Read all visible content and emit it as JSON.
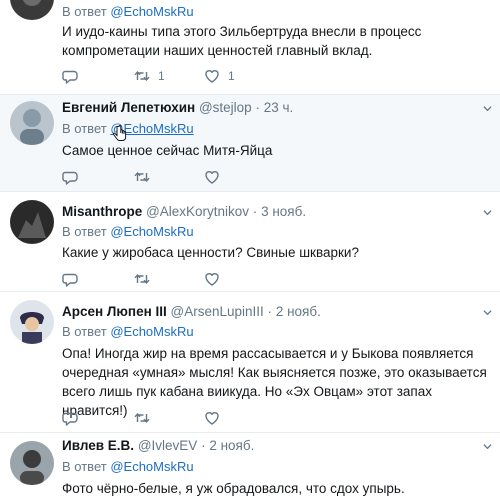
{
  "tweets": [
    {
      "reply_prefix": "В ответ",
      "reply_to": "@EchoMskRu",
      "text": "И иудо-каины типа этого Зильбертруда внесли в процесс компрометации наших ценностей главный вклад.",
      "replies": "",
      "retweets": "1",
      "likes": "1"
    },
    {
      "name": "Евгений Лепетюхин",
      "handle": "@stejlop",
      "sep": "·",
      "time": "23 ч.",
      "reply_prefix": "В ответ",
      "reply_to": "@EchoMskRu",
      "text": "Самое ценное сейчас Митя-Яйца"
    },
    {
      "name": "Misanthrope",
      "handle": "@AlexKorytnikov",
      "sep": "·",
      "time": "3 нояб.",
      "reply_prefix": "В ответ",
      "reply_to": "@EchoMskRu",
      "text": "Какие у жиробаса ценности? Свиные шкварки?"
    },
    {
      "name": "Арсен Люпен III",
      "handle": "@ArsenLupinIII",
      "sep": "·",
      "time": "2 нояб.",
      "reply_prefix": "В ответ",
      "reply_to": "@EchoMskRu",
      "text": "Опа! Иногда жир на время рассасывается и у Быкова появляется очередная «умная» мысля! Как выясняется позже, это оказывается всего лишь пук кабана виикуда. Но «Эх Овцам» этот запах нравится!)"
    },
    {
      "name": "Ивлев Е.В.",
      "handle": "@IvlevEV",
      "sep": "·",
      "time": "2 нояб.",
      "reply_prefix": "В ответ",
      "reply_to": "@EchoMskRu",
      "text": "Фото чёрно-белые, я уж обрадовался, что сдох упырь."
    }
  ],
  "colors": {
    "link": "#1b6ec2",
    "muted": "#657786",
    "hover_bg": "#f5f8fa",
    "divider": "#e6ecf0"
  }
}
